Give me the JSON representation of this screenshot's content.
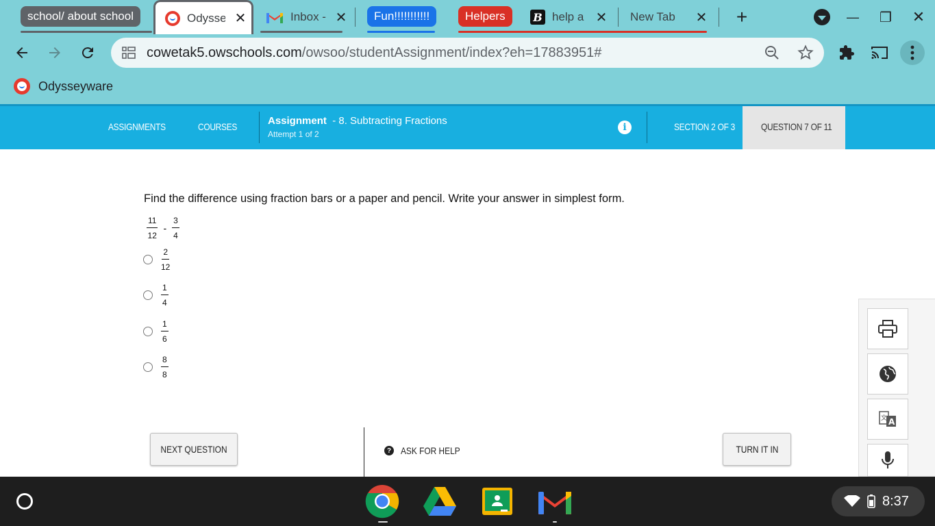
{
  "tabs": {
    "group_school": "school/ about school",
    "odyssey": "Odysse",
    "inbox": "Inbox -",
    "group_fun": "Fun!!!!!!!!!!!",
    "group_helpers": "Helpers",
    "help": "help a",
    "newtab": "New Tab",
    "close_glyph": "✕",
    "new_tab_glyph": "+"
  },
  "window_controls": {
    "minimize": "—",
    "restore": "❐",
    "close": "✕"
  },
  "colors": {
    "group_school": "#5f6368",
    "group_fun": "#1a73e8",
    "group_helpers": "#d93025",
    "nav_blue": "#18afe0"
  },
  "omnibox": {
    "url_host": "cowetak5.owschools.com",
    "url_path": "/owsoo/studentAssignment/index?eh=17883951#"
  },
  "bookmarks": {
    "odysseyware": "Odysseyware"
  },
  "nav": {
    "assignments": "ASSIGNMENTS",
    "courses": "COURSES",
    "assignment_label": "Assignment",
    "assignment_name": "- 8. Subtracting Fractions",
    "attempt": "Attempt 1 of 2",
    "info_glyph": "i",
    "section": "SECTION 2 OF 3",
    "question": "QUESTION 7 OF 11"
  },
  "question": {
    "prompt": "Find the difference using fraction bars or a paper and pencil. Write your answer in simplest form.",
    "problem": {
      "a_num": "11",
      "a_den": "12",
      "op": "-",
      "b_num": "3",
      "b_den": "4"
    },
    "choices": [
      {
        "num": "2",
        "den": "12"
      },
      {
        "num": "1",
        "den": "4"
      },
      {
        "num": "1",
        "den": "6"
      },
      {
        "num": "8",
        "den": "8"
      }
    ]
  },
  "footer": {
    "next": "NEXT QUESTION",
    "ask_help": "ASK FOR HELP",
    "ask_glyph": "?",
    "turn_in": "TURN IT IN"
  },
  "shelf": {
    "time": "8:37"
  }
}
